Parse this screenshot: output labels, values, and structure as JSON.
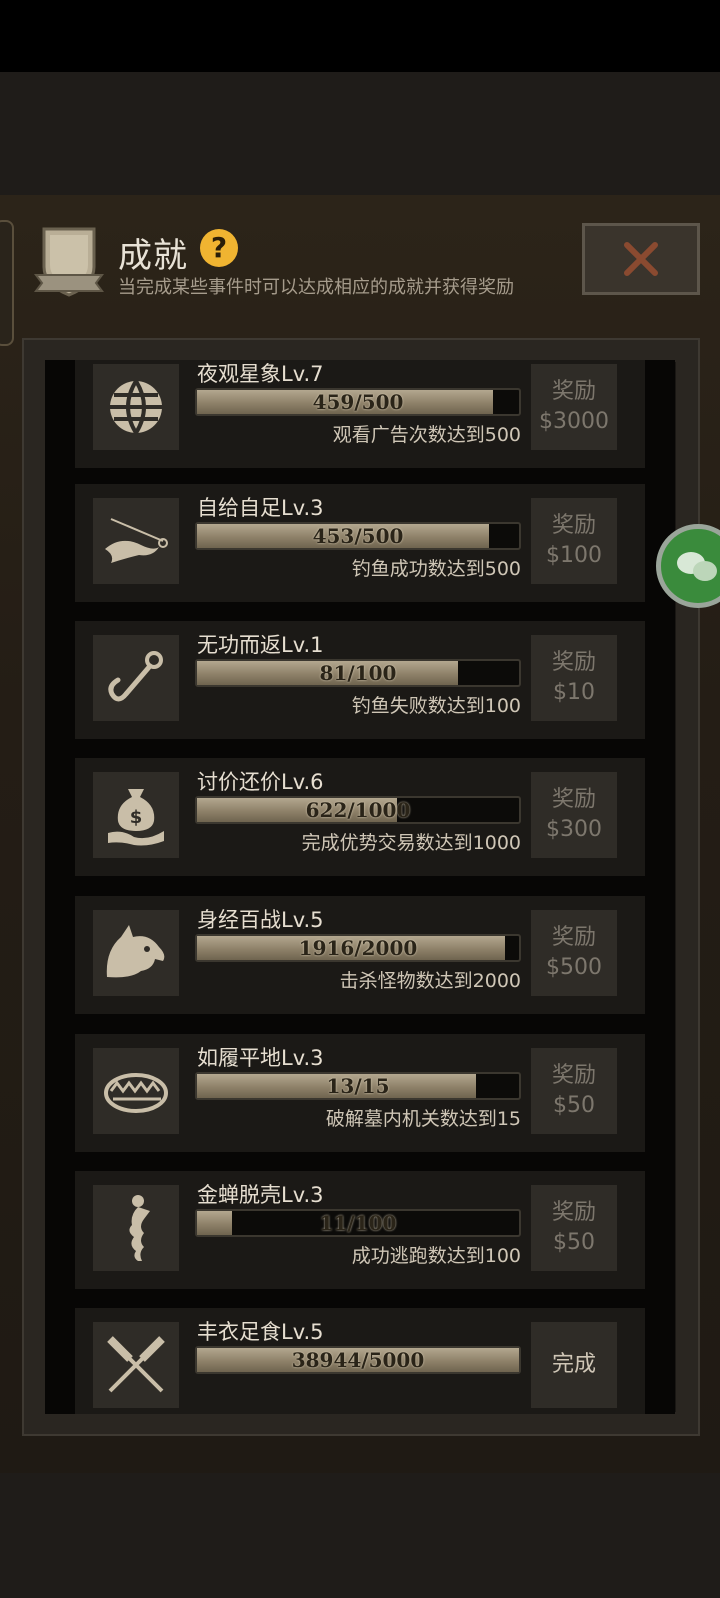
{
  "header": {
    "title": "成就",
    "subtitle": "当完成某些事件时可以达成相应的成就并获得奖励"
  },
  "colors": {
    "help_icon": "#f0b431",
    "close_icon": "#8a4a30",
    "progress_fill": "#9e9178",
    "card_bg": "#1b1916",
    "wechat": "#3a8b3c"
  },
  "achievements": [
    {
      "icon": "globe-icon",
      "name": "夜观星象Lv.7",
      "progress": "459/500",
      "fill": 0.918,
      "desc": "观看广告次数达到500",
      "reward_label": "奖励",
      "reward_value": "$3000"
    },
    {
      "icon": "fishing-hook-fish-icon",
      "name": "自给自足Lv.3",
      "progress": "453/500",
      "fill": 0.906,
      "desc": "钓鱼成功数达到500",
      "reward_label": "奖励",
      "reward_value": "$100"
    },
    {
      "icon": "fish-hook-icon",
      "name": "无功而返Lv.1",
      "progress": "81/100",
      "fill": 0.81,
      "desc": "钓鱼失败数达到100",
      "reward_label": "奖励",
      "reward_value": "$10"
    },
    {
      "icon": "money-bag-hand-icon",
      "name": "讨价还价Lv.6",
      "progress": "622/1000",
      "fill": 0.622,
      "desc": "完成优势交易数达到1000",
      "reward_label": "奖励",
      "reward_value": "$300"
    },
    {
      "icon": "wolf-head-icon",
      "name": "身经百战Lv.5",
      "progress": "1916/2000",
      "fill": 0.958,
      "desc": "击杀怪物数达到2000",
      "reward_label": "奖励",
      "reward_value": "$500"
    },
    {
      "icon": "bear-trap-icon",
      "name": "如履平地Lv.3",
      "progress": "13/15",
      "fill": 0.867,
      "desc": "破解墓内机关数达到15",
      "reward_label": "奖励",
      "reward_value": "$50"
    },
    {
      "icon": "escaping-figure-icon",
      "name": "金蝉脱壳Lv.3",
      "progress": "11/100",
      "fill": 0.11,
      "desc": "成功逃跑数达到100",
      "reward_label": "奖励",
      "reward_value": "$50"
    },
    {
      "icon": "crossed-spatulas-icon",
      "name": "丰衣足食Lv.5",
      "progress": "38944/5000",
      "fill": 1.0,
      "desc": "",
      "reward_label": "完成",
      "reward_value": ""
    }
  ]
}
